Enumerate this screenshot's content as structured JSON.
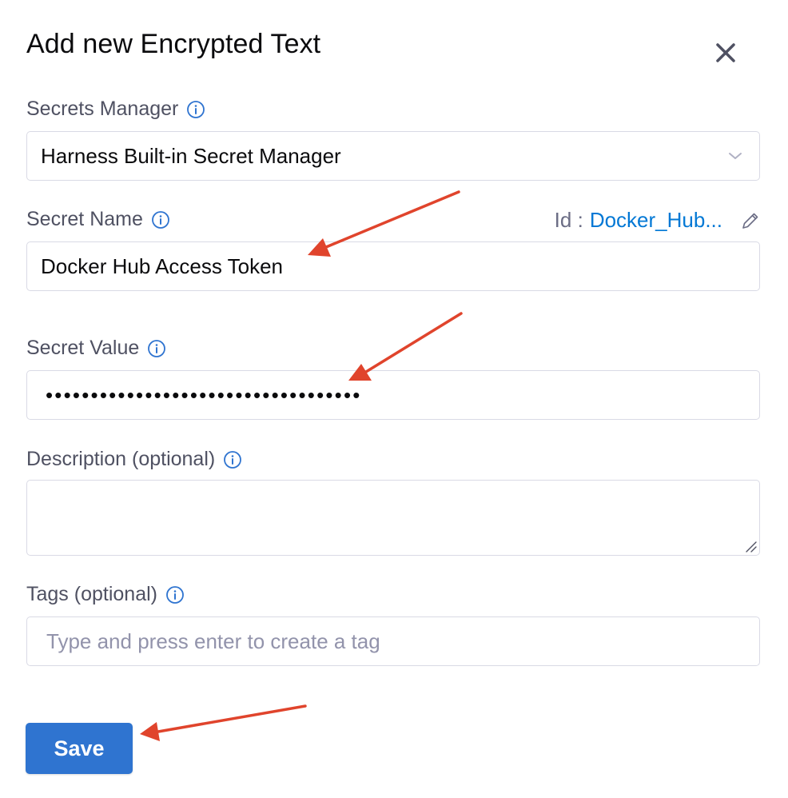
{
  "dialog": {
    "title": "Add new Encrypted Text",
    "close_icon": "close-icon"
  },
  "secrets_manager": {
    "label": "Secrets Manager",
    "selected": "Harness Built-in Secret Manager"
  },
  "secret_name": {
    "label": "Secret Name",
    "id_label": "Id :",
    "id_value": "Docker_Hub...",
    "value": "Docker Hub Access Token"
  },
  "secret_value": {
    "label": "Secret Value",
    "masked": "•••••••••••••••••••••••••••••••••••"
  },
  "description": {
    "label": "Description (optional)",
    "value": ""
  },
  "tags": {
    "label": "Tags (optional)",
    "placeholder": "Type and press enter to create a tag"
  },
  "actions": {
    "save_label": "Save"
  },
  "colors": {
    "accent": "#2f74d0",
    "link": "#0278d5",
    "annotation_arrow": "#e0442c",
    "info_icon": "#2f74d0"
  }
}
